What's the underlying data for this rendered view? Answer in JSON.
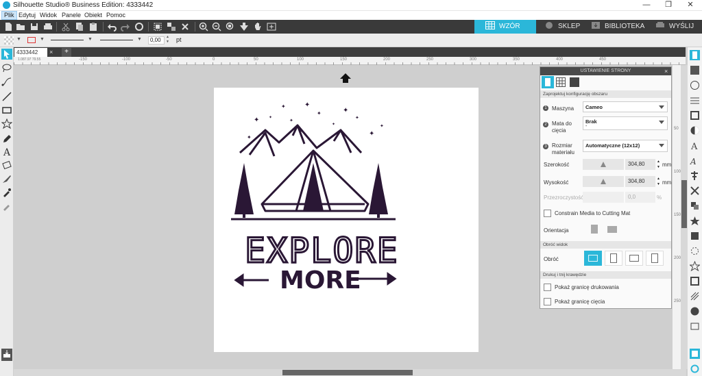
{
  "window": {
    "title": "Silhouette Studio® Business Edition: 4333442",
    "minimize": "—",
    "maximize": "❐",
    "close": "✕"
  },
  "menu": [
    "Plik",
    "Edytuj",
    "Widok",
    "Panele",
    "Obiekt",
    "Pomoc"
  ],
  "nav_tabs": {
    "design": "WZÓR",
    "store": "SKLEP",
    "library": "BIBLIOTEKA",
    "send": "WYŚLIJ"
  },
  "linebar": {
    "width_value": "0,00",
    "unit": "pt"
  },
  "document_tab": {
    "name": "4333442",
    "close": "×",
    "add": "+"
  },
  "ruler": {
    "h_ticks": [
      "-150",
      "-100",
      "-50",
      "0",
      "50",
      "100",
      "150",
      "200",
      "250",
      "300",
      "350",
      "400",
      "450"
    ],
    "v_ticks": [
      "50",
      "100",
      "150",
      "200",
      "250"
    ],
    "coords": "1.087.97  79.55"
  },
  "artwork": {
    "line1": "EXPLORE",
    "line2": "MORE",
    "ink_color": "#2a1735"
  },
  "panel": {
    "title": "USTAWIENIE STRONY",
    "close": "×",
    "section_config": "Zaprojektuj konfigurację obszaru",
    "machine_label": "Maszyna",
    "machine_value": "Cameo",
    "mat_label": "Mata do cięcia",
    "mat_value": "Brak",
    "mat_sub": "-",
    "media_label": "Rozmiar materiału",
    "media_value": "Automatyczne (12x12)",
    "width_label": "Szerokość",
    "width_value": "304,80",
    "height_label": "Wysokość",
    "height_value": "304,80",
    "unit": "mm",
    "transparency_label": "Przezroczystość",
    "transparency_value": "0,0",
    "transparency_unit": "%",
    "constrain_label": "Constrain Media to Cutting Mat",
    "orientation_label": "Orientacja",
    "section_rotate": "Obróć widok",
    "rotate_label": "Obróć",
    "section_print": "Drukuj i tnij krawędzie",
    "show_print_border": "Pokaż granicę drukowania",
    "show_cut_border": "Pokaż granicę cięcia"
  },
  "colors": {
    "accent": "#2bb7d9",
    "toolbar": "#3a3a3a",
    "ink": "#2a1735"
  }
}
